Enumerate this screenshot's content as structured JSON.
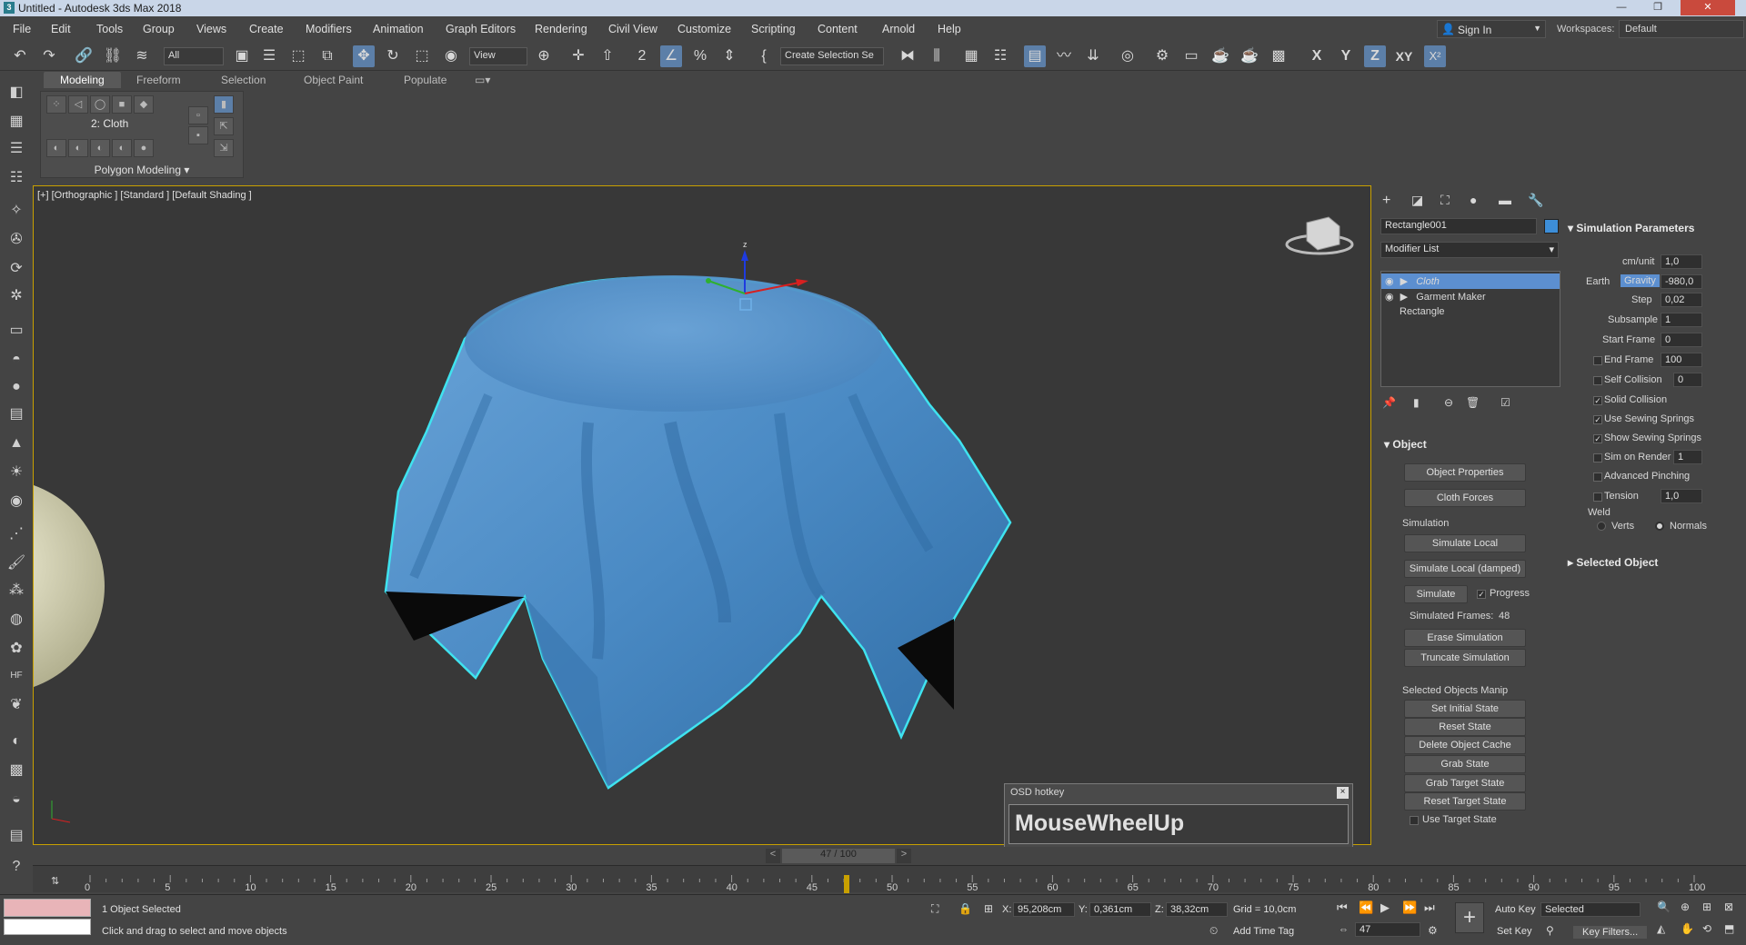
{
  "titlebar": {
    "title": "Untitled - Autodesk 3ds Max 2018",
    "app_icon": "3"
  },
  "menu": [
    "File",
    "Edit",
    "Tools",
    "Group",
    "Views",
    "Create",
    "Modifiers",
    "Animation",
    "Graph Editors",
    "Rendering",
    "Civil View",
    "Customize",
    "Scripting",
    "Content",
    "Arnold",
    "Help"
  ],
  "signin": {
    "label": "Sign In"
  },
  "workspaces": {
    "label": "Workspaces:",
    "value": "Default"
  },
  "toolbar": {
    "filter": "All",
    "ref_coord": "View",
    "selection_set": "Create Selection Se",
    "axis": [
      "X",
      "Y",
      "Z",
      "XY"
    ]
  },
  "ribbon": {
    "tabs": [
      "Modeling",
      "Freeform",
      "Selection",
      "Object Paint",
      "Populate"
    ],
    "active_tab": "Modeling",
    "object_label": "2: Cloth",
    "panel_label": "Polygon Modeling"
  },
  "viewport": {
    "label": "[+] [Orthographic ] [Standard ] [Default Shading ]",
    "axis_z": "z"
  },
  "command_panel": {
    "object_name": "Rectangle001",
    "object_color": "#3d8ed8",
    "modifier_list": "Modifier List",
    "stack": [
      {
        "name": "Cloth",
        "selected": true
      },
      {
        "name": "Garment Maker",
        "selected": false
      },
      {
        "name": "Rectangle",
        "selected": false
      }
    ],
    "object_rollout": {
      "title": "Object",
      "buttons": [
        "Object Properties",
        "Cloth Forces"
      ],
      "simulation_label": "Simulation",
      "simulate_local": "Simulate Local",
      "simulate_local_damped": "Simulate Local (damped)",
      "simulate": "Simulate",
      "progress": "Progress",
      "simulated_frames_label": "Simulated Frames:",
      "simulated_frames_value": "48",
      "erase": "Erase Simulation",
      "truncate": "Truncate Simulation",
      "selected_manip_label": "Selected Objects Manip",
      "manip_buttons": [
        "Set Initial State",
        "Reset State",
        "Delete Object Cache",
        "Grab State",
        "Grab Target State",
        "Reset Target State"
      ],
      "use_target_state": "Use Target State"
    },
    "sim_params": {
      "title": "Simulation Parameters",
      "cm_unit_label": "cm/unit",
      "cm_unit": "1,0",
      "earth": "Earth",
      "gravity": "Gravity",
      "gravity_value": "-980,0",
      "step_label": "Step",
      "step": "0,02",
      "subsample_label": "Subsample",
      "subsample": "1",
      "start_frame_label": "Start Frame",
      "start_frame": "0",
      "end_frame_label": "End Frame",
      "end_frame": "100",
      "self_collision_label": "Self Collision",
      "self_collision": "0",
      "solid_collision": "Solid Collision",
      "use_sewing_springs": "Use Sewing Springs",
      "show_sewing_springs": "Show Sewing Springs",
      "sim_on_render_label": "Sim on Render",
      "sim_on_render": "1",
      "advanced_pinching": "Advanced Pinching",
      "tension_label": "Tension",
      "tension": "1,0",
      "weld": "Weld",
      "verts": "Verts",
      "normals": "Normals"
    },
    "selected_object_title": "Selected Object"
  },
  "osd": {
    "title": "OSD hotkey",
    "text": "MouseWheelUp"
  },
  "timeslider": {
    "label": "47 / 100",
    "frame": 47,
    "total": 100
  },
  "trackbar": {
    "ticks": [
      0,
      5,
      10,
      15,
      20,
      25,
      30,
      35,
      40,
      45,
      50,
      55,
      60,
      65,
      70,
      75,
      80,
      85,
      90,
      95,
      100
    ]
  },
  "status": {
    "selected": "1 Object Selected",
    "prompt": "Click and drag to select and move objects",
    "x_label": "X:",
    "x": "95,208cm",
    "y_label": "Y:",
    "y": "0,361cm",
    "z_label": "Z:",
    "z": "38,32cm",
    "grid": "Grid = 10,0cm",
    "add_time_tag": "Add Time Tag",
    "auto_key": "Auto Key",
    "key_mode": "Selected",
    "set_key": "Set Key",
    "key_filters": "Key Filters...",
    "frame": "47"
  }
}
